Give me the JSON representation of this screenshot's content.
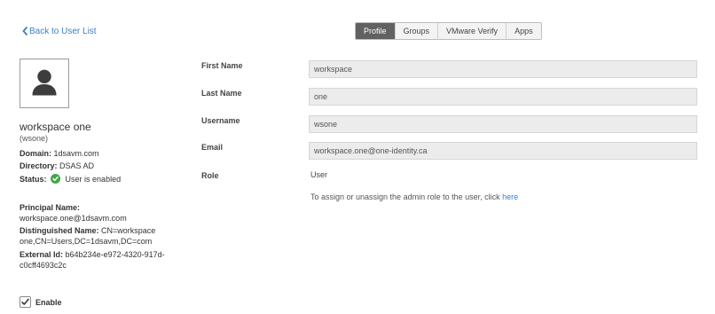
{
  "nav": {
    "back_label": "Back to User List"
  },
  "tabs": [
    {
      "label": "Profile",
      "active": true
    },
    {
      "label": "Groups",
      "active": false
    },
    {
      "label": "VMware Verify",
      "active": false
    },
    {
      "label": "Apps",
      "active": false
    }
  ],
  "user": {
    "avatar_icon": "user-silhouette-icon",
    "display_name": "workspace one",
    "login": "(wsone)",
    "domain": {
      "label": "Domain:",
      "value": "1dsavm.com"
    },
    "directory": {
      "label": "Directory:",
      "value": "DSAS AD"
    },
    "status": {
      "label": "Status:",
      "value": "User is enabled",
      "icon": "check-circle-icon",
      "color": "#45a745"
    },
    "principal_name": {
      "label": "Principal Name:",
      "value": "workspace.one@1dsavm.com"
    },
    "distinguished_name": {
      "label": "Distinguished Name:",
      "value": "CN=workspace one,CN=Users,DC=1dsavm,DC=com"
    },
    "external_id": {
      "label": "External Id:",
      "value": "b64b234e-e972-4320-917d-c0cff4693c2c"
    },
    "enable": {
      "label": "Enable",
      "checked": true
    }
  },
  "profile": {
    "first_name": {
      "label": "First Name",
      "value": "workspace"
    },
    "last_name": {
      "label": "Last Name",
      "value": "one"
    },
    "username": {
      "label": "Username",
      "value": "wsone"
    },
    "email": {
      "label": "Email",
      "value": "workspace.one@one-identity.ca"
    },
    "role": {
      "label": "Role",
      "value": "User"
    },
    "admin_note": {
      "text": "To assign or unassign the admin role to the user, click ",
      "link": "here"
    }
  },
  "colors": {
    "link": "#3b7fc4",
    "active_tab": "#616161",
    "input_bg": "#ececec",
    "status_ok": "#45a745"
  }
}
